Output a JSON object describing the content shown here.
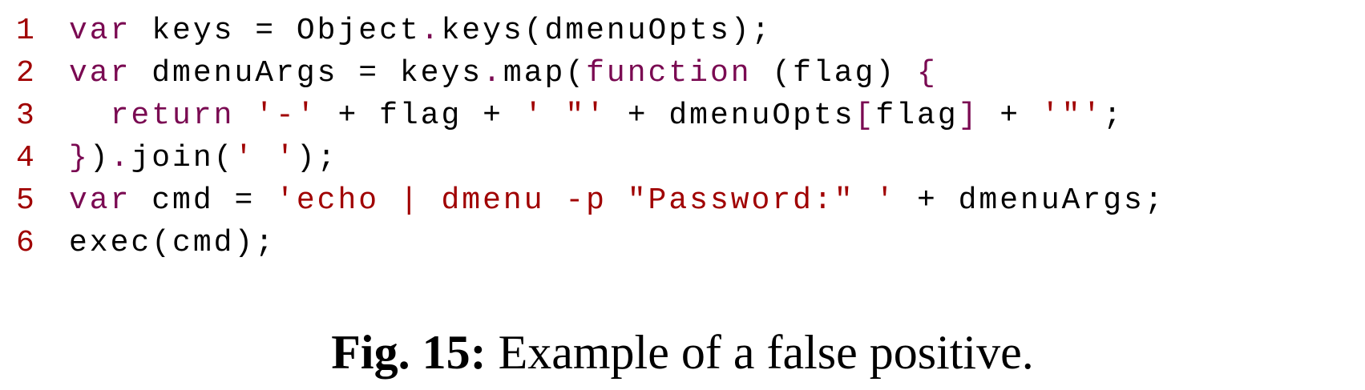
{
  "code_lines": [
    {
      "number": "1",
      "tokens": [
        {
          "text": "var",
          "kind": "kw"
        },
        {
          "text": " keys = Object",
          "kind": "pl"
        },
        {
          "text": ".",
          "kind": "dot"
        },
        {
          "text": "keys(dmenuOpts);",
          "kind": "pl"
        }
      ]
    },
    {
      "number": "2",
      "tokens": [
        {
          "text": "var",
          "kind": "kw"
        },
        {
          "text": " dmenuArgs = keys",
          "kind": "pl"
        },
        {
          "text": ".",
          "kind": "dot"
        },
        {
          "text": "map(",
          "kind": "pl"
        },
        {
          "text": "function",
          "kind": "kw"
        },
        {
          "text": " (flag) ",
          "kind": "pl"
        },
        {
          "text": "{",
          "kind": "br"
        }
      ]
    },
    {
      "number": "3",
      "tokens": [
        {
          "text": "  ",
          "kind": "pl"
        },
        {
          "text": "return",
          "kind": "kw"
        },
        {
          "text": " ",
          "kind": "pl"
        },
        {
          "text": "'-'",
          "kind": "str"
        },
        {
          "text": " + flag + ",
          "kind": "pl"
        },
        {
          "text": "' \"'",
          "kind": "str"
        },
        {
          "text": " + dmenuOpts",
          "kind": "pl"
        },
        {
          "text": "[",
          "kind": "br"
        },
        {
          "text": "flag",
          "kind": "pl"
        },
        {
          "text": "]",
          "kind": "br"
        },
        {
          "text": " + ",
          "kind": "pl"
        },
        {
          "text": "'\"'",
          "kind": "str"
        },
        {
          "text": ";",
          "kind": "pl"
        }
      ]
    },
    {
      "number": "4",
      "tokens": [
        {
          "text": "}",
          "kind": "br"
        },
        {
          "text": ")",
          "kind": "pl"
        },
        {
          "text": ".",
          "kind": "dot"
        },
        {
          "text": "join(",
          "kind": "pl"
        },
        {
          "text": "' '",
          "kind": "str"
        },
        {
          "text": ");",
          "kind": "pl"
        }
      ]
    },
    {
      "number": "5",
      "tokens": [
        {
          "text": "var",
          "kind": "kw"
        },
        {
          "text": " cmd = ",
          "kind": "pl"
        },
        {
          "text": "'echo | dmenu -p \"Password:\" '",
          "kind": "str"
        },
        {
          "text": " + dmenuArgs;",
          "kind": "pl"
        }
      ]
    },
    {
      "number": "6",
      "tokens": [
        {
          "text": "exec(cmd);",
          "kind": "pl"
        }
      ]
    }
  ],
  "caption": {
    "label": "Fig. 15:",
    "text": " Example of a false positive."
  },
  "colors": {
    "keyword": "#7a0a52",
    "string": "#a00000",
    "line_number": "#a00000",
    "plain": "#000000"
  }
}
